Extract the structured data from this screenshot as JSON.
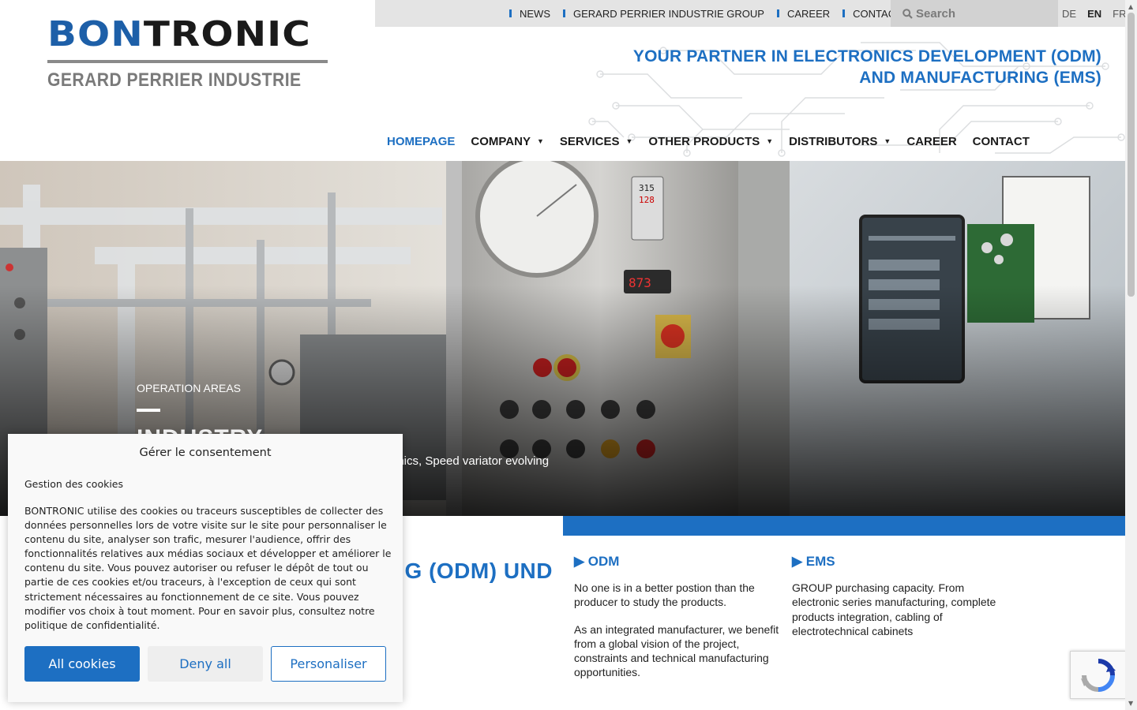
{
  "brand": {
    "logo_primary_a": "BON",
    "logo_primary_b": "TRONIC",
    "logo_secondary": "GERARD PERRIER INDUSTRIE",
    "accent_color": "#1d6fc2",
    "dark_color": "#1a1a1a"
  },
  "topbar": {
    "links": [
      "NEWS",
      "GERARD PERRIER INDUSTRIE GROUP",
      "CAREER",
      "CONTACT"
    ],
    "search_placeholder": "Search",
    "search_icon": "search-icon",
    "languages": [
      {
        "code": "DE",
        "active": false
      },
      {
        "code": "EN",
        "active": true
      },
      {
        "code": "FR",
        "active": false
      }
    ]
  },
  "tagline": {
    "line1": "YOUR PARTNER IN ELECTRONICS DEVELOPMENT (ODM)",
    "line2": "AND MANUFACTURING (EMS)"
  },
  "nav": {
    "items": [
      {
        "label": "HOMEPAGE",
        "active": true,
        "dropdown": false
      },
      {
        "label": "COMPANY",
        "active": false,
        "dropdown": true
      },
      {
        "label": "SERVICES",
        "active": false,
        "dropdown": true
      },
      {
        "label": "OTHER PRODUCTS",
        "active": false,
        "dropdown": true
      },
      {
        "label": "DISTRIBUTORS",
        "active": false,
        "dropdown": true
      },
      {
        "label": "CAREER",
        "active": false,
        "dropdown": false
      },
      {
        "label": "CONTACT",
        "active": false,
        "dropdown": false
      }
    ],
    "caret": "▾"
  },
  "hero": {
    "kicker": "OPERATION AREAS",
    "title": "INDUSTRY",
    "description": "onics, Speed variator evolving",
    "display_top": "315",
    "display_mid": "128",
    "display_red": "873"
  },
  "content": {
    "title_fragment": "G (ODM) UND",
    "odm": {
      "heading": "▶ ODM",
      "paragraphs": [
        "No one is in a better postion than the producer to study the products.",
        "As an integrated manufacturer, we benefit from a global vision of the project, constraints and technical manufacturing opportunities."
      ]
    },
    "ems": {
      "heading": "▶ EMS",
      "paragraphs": [
        "GROUP purchasing capacity. From electronic series manufacturing, complete products integration, cabling of electrotechnical cabinets"
      ]
    }
  },
  "cookie": {
    "title": "Gérer le consentement",
    "subtitle": "Gestion des cookies",
    "body": "BONTRONIC utilise des cookies ou traceurs susceptibles de collecter des données personnelles lors de votre visite sur le site pour personnaliser le contenu du site, analyser son trafic, mesurer l'audience, offrir des fonctionnalités relatives aux médias sociaux et développer et améliorer le contenu du site. Vous pouvez autoriser ou refuser le dépôt de tout ou partie de ces cookies et/ou traceurs, à l'exception de ceux qui sont strictement nécessaires au fonctionnement de ce site. Vous pouvez modifier vos choix à tout moment. Pour en savoir plus, consultez notre politique de confidentialité.",
    "accept_label": "All cookies",
    "deny_label": "Deny all",
    "custom_label": "Personaliser"
  },
  "recaptcha": {
    "icon": "recaptcha-icon"
  }
}
